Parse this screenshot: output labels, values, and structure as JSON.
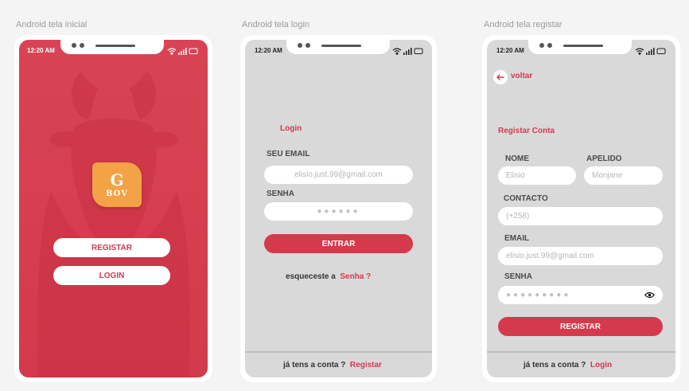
{
  "labels": {
    "frame1": "Android tela inicial",
    "frame2": "Android tela login",
    "frame3": "Android tela registar"
  },
  "status": {
    "time": "12:20 AM"
  },
  "splash": {
    "logo_g": "G",
    "logo_bov": "BOV",
    "register_label": "REGISTAR",
    "login_label": "LOGIN"
  },
  "login": {
    "title": "Login",
    "email_label": "SEU EMAIL",
    "email_value": "elisio.just.99@gmail.com",
    "password_label": "SENHA",
    "password_dots": "●●●●●●",
    "submit_label": "ENTRAR",
    "forgot_prefix": "esqueceste a",
    "forgot_link": "Senha ?",
    "footer_prefix": "já tens a conta ?",
    "footer_link": "Registar"
  },
  "register": {
    "back_label": "voltar",
    "title": "Registar Conta",
    "name_label": "NOME",
    "name_placeholder": "Elisio",
    "surname_label": "APELIDO",
    "surname_placeholder": "Monjane",
    "contact_label": "CONTACTO",
    "contact_placeholder": "(+258)",
    "email_label": "EMAIL",
    "email_placeholder": "elisio.just.99@gmail.com",
    "password_label": "SENHA",
    "password_dots": "●●●●●●●●●",
    "submit_label": "REGISTAR",
    "footer_prefix": "já tens a conta ?",
    "footer_link": "Login"
  },
  "colors": {
    "accent": "#d43a4c",
    "splash_bg": "#d84455",
    "screen_bg": "#d9d9d9",
    "logo": "#f3a245"
  },
  "icons": [
    "wifi-icon",
    "signal-icon",
    "battery-icon",
    "back-arrow-icon",
    "eye-icon"
  ]
}
